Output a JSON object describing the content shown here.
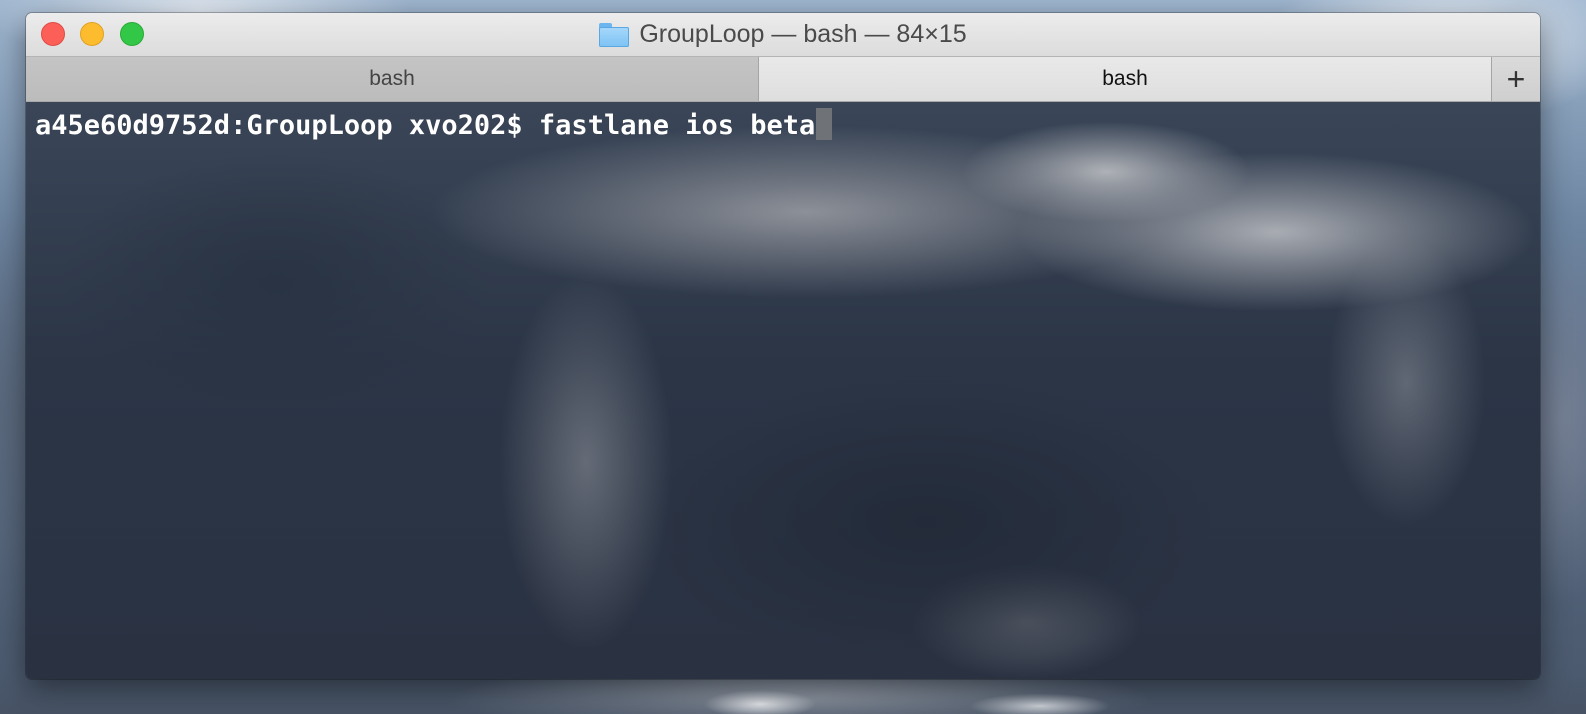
{
  "window": {
    "title": "GroupLoop — bash — 84×15",
    "folder_icon": "folder-icon"
  },
  "tabs": [
    {
      "label": "bash",
      "active": false
    },
    {
      "label": "bash",
      "active": true
    }
  ],
  "new_tab": {
    "label": "+"
  },
  "terminal": {
    "prompt": "a45e60d9752d:GroupLoop xvo202$ ",
    "command": "fastlane ios beta"
  },
  "colors": {
    "close": "#fc5f57",
    "minimize": "#fdbc2e",
    "zoom": "#33c748",
    "terminal_text": "#ffffff"
  }
}
